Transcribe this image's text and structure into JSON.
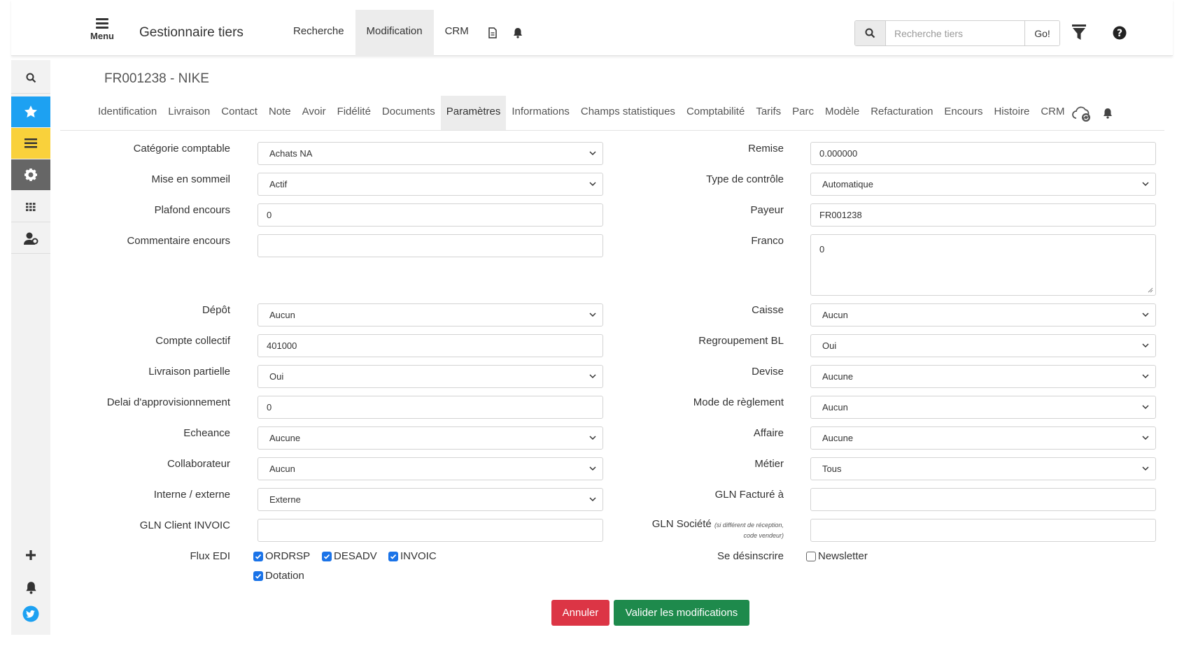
{
  "header": {
    "menu_label": "Menu",
    "app_title": "Gestionnaire tiers",
    "nav": [
      "Recherche",
      "Modification",
      "CRM"
    ],
    "search_placeholder": "Recherche tiers",
    "go_label": "Go!"
  },
  "record": {
    "title": "FR001238 - NIKE"
  },
  "tabs": [
    "Identification",
    "Livraison",
    "Contact",
    "Note",
    "Avoir",
    "Fidélité",
    "Documents",
    "Paramètres",
    "Informations",
    "Champs statistiques",
    "Comptabilité",
    "Tarifs",
    "Parc",
    "Modèle",
    "Refacturation",
    "Encours",
    "Histoire",
    "CRM"
  ],
  "active_tab": "Paramètres",
  "left_form": {
    "categorie": {
      "label": "Catégorie comptable",
      "value": "Achats NA"
    },
    "sommeil": {
      "label": "Mise en sommeil",
      "value": "Actif"
    },
    "plafond": {
      "label": "Plafond encours",
      "value": "0"
    },
    "commentaire": {
      "label": "Commentaire encours",
      "value": ""
    },
    "depot": {
      "label": "Dépôt",
      "value": "Aucun"
    },
    "compte": {
      "label": "Compte collectif",
      "value": "401000"
    },
    "livraison": {
      "label": "Livraison partielle",
      "value": "Oui"
    },
    "delai": {
      "label": "Delai d'approvisionnement",
      "value": "0"
    },
    "echeance": {
      "label": "Echeance",
      "value": "Aucune"
    },
    "collaborateur": {
      "label": "Collaborateur",
      "value": "Aucun"
    },
    "interne": {
      "label": "Interne / externe",
      "value": "Externe"
    },
    "gln_client": {
      "label": "GLN Client INVOIC",
      "value": ""
    },
    "flux": {
      "label": "Flux EDI",
      "options": [
        "ORDRSP",
        "DESADV",
        "INVOIC",
        "Dotation"
      ]
    }
  },
  "right_form": {
    "remise": {
      "label": "Remise",
      "value": "0.000000"
    },
    "type_controle": {
      "label": "Type de contrôle",
      "value": "Automatique"
    },
    "payeur": {
      "label": "Payeur",
      "value": "FR001238"
    },
    "franco": {
      "label": "Franco",
      "value": "0"
    },
    "caisse": {
      "label": "Caisse",
      "value": "Aucun"
    },
    "regroupement": {
      "label": "Regroupement BL",
      "value": "Oui"
    },
    "devise": {
      "label": "Devise",
      "value": "Aucune"
    },
    "mode": {
      "label": "Mode de règlement",
      "value": "Aucun"
    },
    "affaire": {
      "label": "Affaire",
      "value": "Aucune"
    },
    "metier": {
      "label": "Métier",
      "value": "Tous"
    },
    "gln_facture": {
      "label": "GLN Facturé à",
      "value": ""
    },
    "gln_societe": {
      "label": "GLN Société",
      "note_line1": "(si différent de réception,",
      "note_line2": "code vendeur)",
      "value": ""
    },
    "desinscrire": {
      "label": "Se désinscrire",
      "option": "Newsletter"
    }
  },
  "actions": {
    "cancel": "Annuler",
    "save": "Valider les modifications"
  },
  "colors": {
    "cancel": "#dc3545",
    "save": "#1e8a4c",
    "sidebar_active": "#1da1f2",
    "sidebar_yellow": "#f9d13b",
    "sidebar_dark": "#666666"
  }
}
